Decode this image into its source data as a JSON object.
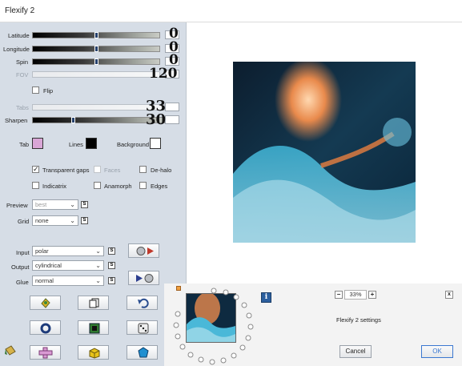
{
  "window": {
    "title": "Flexify 2"
  },
  "sliders": [
    {
      "key": "latitude",
      "label": "Latitude",
      "value": "0",
      "box": "0",
      "enabled": true,
      "level": 0.5
    },
    {
      "key": "longitude",
      "label": "Longitude",
      "value": "0",
      "box": "0",
      "enabled": true,
      "level": 0.5
    },
    {
      "key": "spin",
      "label": "Spin",
      "value": "0",
      "box": "0",
      "enabled": true,
      "level": 0.5
    },
    {
      "key": "fov",
      "label": "FOV",
      "value": "120",
      "box": "120",
      "enabled": false,
      "level": 0.5
    }
  ],
  "flip": {
    "label": "Flip",
    "checked": false
  },
  "tabs_slider": {
    "label": "Tabs",
    "value": "33",
    "box": "33",
    "enabled": false
  },
  "sharpen_slider": {
    "label": "Sharpen",
    "value": "30",
    "box": "30",
    "enabled": true,
    "level": 0.3
  },
  "colors": {
    "tab": {
      "label": "Tab",
      "color": "#d9a6d6"
    },
    "lines": {
      "label": "Lines",
      "color": "#000000"
    },
    "background": {
      "label": "Background",
      "color": "#ffffff"
    }
  },
  "options": {
    "transparent_gaps": {
      "label": "Transparent gaps",
      "checked": true
    },
    "faces": {
      "label": "Faces",
      "checked": false,
      "enabled": false
    },
    "de_halo": {
      "label": "De-halo",
      "checked": false
    },
    "indicatrix": {
      "label": "Indicatrix",
      "checked": false
    },
    "anamorph": {
      "label": "Anamorph",
      "checked": false
    },
    "edges": {
      "label": "Edges",
      "checked": false
    }
  },
  "preview": {
    "label": "Preview",
    "value": "best"
  },
  "grid": {
    "label": "Grid",
    "value": "none"
  },
  "projection": {
    "input": {
      "label": "Input",
      "value": "polar"
    },
    "output": {
      "label": "Output",
      "value": "cylindrical"
    },
    "glue": {
      "label": "Glue",
      "value": "normal"
    }
  },
  "link_symbol": "S",
  "zoom": {
    "value": "33%",
    "minus": "−",
    "plus": "+"
  },
  "info_icon": "i",
  "collapse_icon": "x",
  "settings_name": "Flexify 2 settings",
  "buttons": {
    "cancel": "Cancel",
    "ok": "OK"
  },
  "icons": {
    "toolbar": [
      "random-tab-icon",
      "copy-icon",
      "undo-icon",
      "ring-icon",
      "frame-icon",
      "dice-icon",
      "cross-icon",
      "cube-icon",
      "polyhedron-icon"
    ],
    "paint": "paint-bucket-icon",
    "projection_arrows": [
      "sphere-to-flat-icon",
      "flat-to-sphere-icon"
    ]
  }
}
